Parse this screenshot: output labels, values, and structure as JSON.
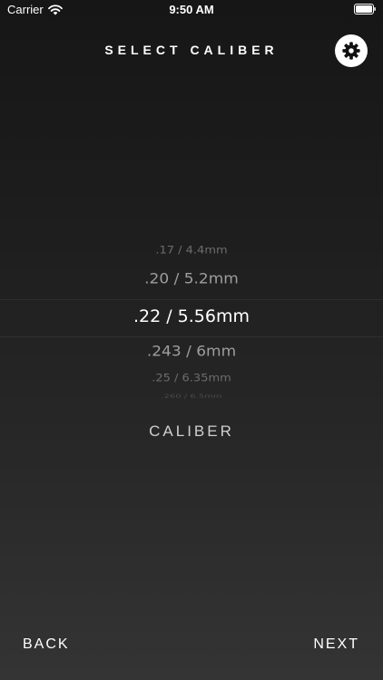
{
  "status_bar": {
    "carrier": "Carrier",
    "time": "9:50 AM",
    "icons": [
      "wifi-icon",
      "battery-icon"
    ]
  },
  "header": {
    "title": "SELECT CALIBER",
    "settings_icon": "gear-icon"
  },
  "picker": {
    "label": "CALIBER",
    "selected_index": 2,
    "options": [
      ".17 / 4.4mm",
      ".20 / 5.2mm",
      ".22 / 5.56mm",
      ".243 / 6mm",
      ".25 / 6.35mm",
      ".260 / 6.5mm"
    ]
  },
  "nav": {
    "back_label": "BACK",
    "next_label": "NEXT"
  },
  "colors": {
    "text": "#ffffff",
    "dim_text": "#9e9e9e",
    "background_top": "#161616",
    "background_bottom": "#343434"
  }
}
